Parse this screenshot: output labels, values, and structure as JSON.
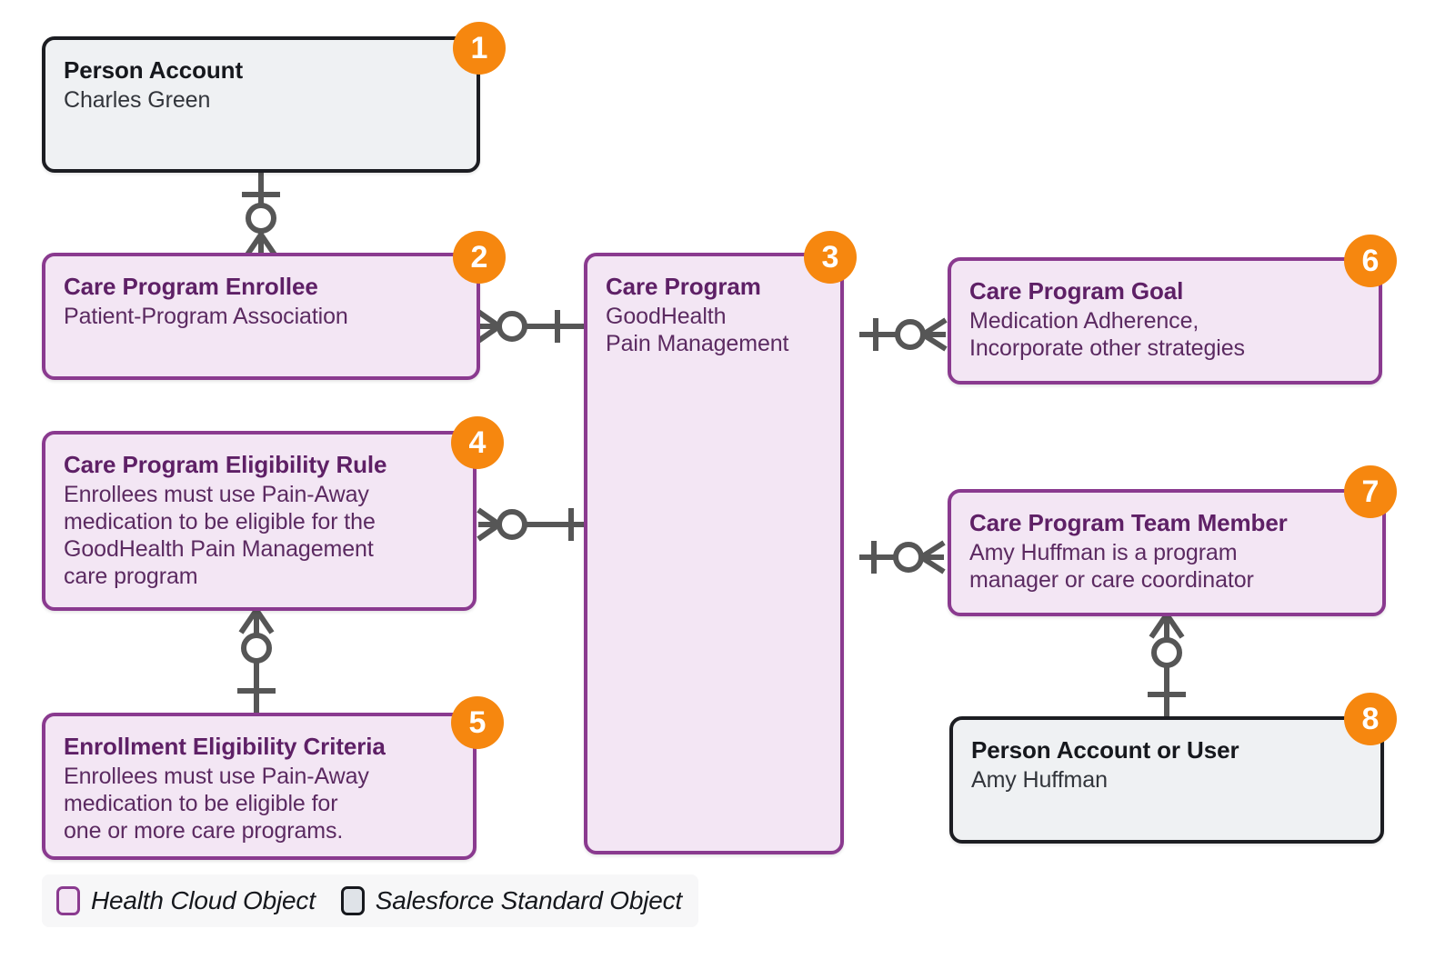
{
  "diagram": {
    "type": "entity-relationship",
    "colors": {
      "health_cloud_fill": "#f3e6f4",
      "health_cloud_border": "#8a3a8f",
      "standard_fill": "#eff1f3",
      "standard_border": "#1c1d22",
      "badge": "#f6870f",
      "connector": "#565656",
      "legend_background": "#f7f7f8"
    },
    "nodes": [
      {
        "id": "person-account",
        "badge": "1",
        "kind": "salesforce-standard",
        "title": "Person Account",
        "subtitle": "Charles Green"
      },
      {
        "id": "care-program-enrollee",
        "badge": "2",
        "kind": "health-cloud",
        "title": "Care Program Enrollee",
        "subtitle": "Patient-Program Association"
      },
      {
        "id": "care-program",
        "badge": "3",
        "kind": "health-cloud",
        "title": "Care Program",
        "subtitle": "GoodHealth\nPain Management"
      },
      {
        "id": "care-program-eligibility-rule",
        "badge": "4",
        "kind": "health-cloud",
        "title": "Care Program Eligibility Rule",
        "subtitle": "Enrollees must use Pain-Away\nmedication to be eligible for the\nGoodHealth Pain Management\ncare program"
      },
      {
        "id": "enrollment-eligibility-criteria",
        "badge": "5",
        "kind": "health-cloud",
        "title": "Enrollment Eligibility Criteria",
        "subtitle": "Enrollees must use Pain-Away\nmedication to be eligible for\none or more care programs."
      },
      {
        "id": "care-program-goal",
        "badge": "6",
        "kind": "health-cloud",
        "title": "Care Program Goal",
        "subtitle": "Medication Adherence,\nIncorporate other strategies"
      },
      {
        "id": "care-program-team-member",
        "badge": "7",
        "kind": "health-cloud",
        "title": "Care Program Team Member",
        "subtitle": "Amy Huffman is a program\nmanager or care coordinator"
      },
      {
        "id": "person-account-or-user",
        "badge": "8",
        "kind": "salesforce-standard",
        "title": "Person Account or User",
        "subtitle": "Amy Huffman"
      }
    ],
    "relationships": [
      {
        "from": "person-account",
        "to": "care-program-enrollee",
        "from_cardinality": "one",
        "to_cardinality": "zero-or-many"
      },
      {
        "from": "care-program-enrollee",
        "to": "care-program",
        "from_cardinality": "zero-or-many",
        "to_cardinality": "one"
      },
      {
        "from": "care-program",
        "to": "care-program-goal",
        "from_cardinality": "one",
        "to_cardinality": "zero-or-many"
      },
      {
        "from": "care-program-eligibility-rule",
        "to": "care-program",
        "from_cardinality": "zero-or-many",
        "to_cardinality": "one"
      },
      {
        "from": "care-program-eligibility-rule",
        "to": "enrollment-eligibility-criteria",
        "from_cardinality": "zero-or-many",
        "to_cardinality": "one"
      },
      {
        "from": "care-program",
        "to": "care-program-team-member",
        "from_cardinality": "one",
        "to_cardinality": "zero-or-many"
      },
      {
        "from": "care-program-team-member",
        "to": "person-account-or-user",
        "from_cardinality": "zero-or-many",
        "to_cardinality": "one"
      }
    ]
  },
  "legend": {
    "items": [
      {
        "id": "health-cloud",
        "label": "Health Cloud Object"
      },
      {
        "id": "salesforce-standard",
        "label": "Salesforce Standard Object"
      }
    ]
  }
}
